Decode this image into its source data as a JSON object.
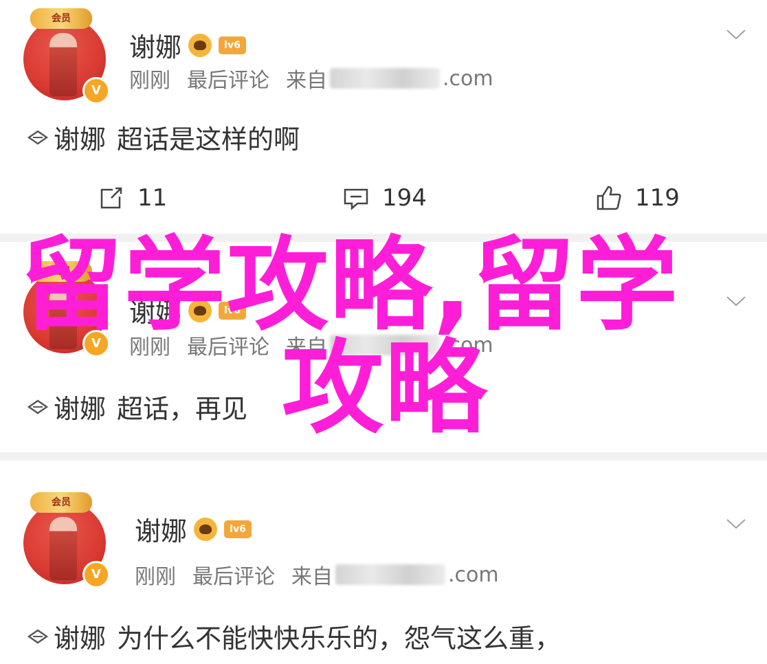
{
  "posts": [
    {
      "username": "谢娜",
      "avatar_deco": "会员",
      "badge_lv": "lv6",
      "meta_time": "刚刚",
      "meta_action": "最后评论",
      "meta_source_prefix": "来自",
      "meta_source_suffix": ".com",
      "comment_topic": "谢娜",
      "comment_text": "超话是这样的啊",
      "share_count": "11",
      "comment_count": "194",
      "like_count": "119"
    },
    {
      "username": "谢娜",
      "avatar_deco": "会员",
      "badge_lv": "lv6",
      "meta_time": "刚刚",
      "meta_action": "最后评论",
      "meta_source_prefix": "来自",
      "meta_source_suffix": ".com",
      "comment_topic": "谢娜",
      "comment_text": "超话，再见"
    },
    {
      "username": "谢娜",
      "avatar_deco": "会员",
      "badge_lv": "lv6",
      "meta_time": "刚刚",
      "meta_action": "最后评论",
      "meta_source_prefix": "来自",
      "meta_source_suffix": ".com",
      "comment_topic": "谢娜",
      "comment_text": "为什么不能快快乐乐的，怨气这么重，"
    }
  ],
  "watermark": {
    "line1": "留学攻略,留学",
    "line2": "攻略",
    "color": "#ff1ed8"
  },
  "icons": {
    "share": "share-icon",
    "comment": "comment-icon",
    "like": "thumbs-up-icon",
    "chevron": "chevron-down-icon",
    "topic": "topic-diamond-icon",
    "verify": "verified-v-icon"
  },
  "colors": {
    "avatar_bg": "#d93a32",
    "verify_badge": "#f6a623",
    "text_primary": "#333333",
    "text_meta": "#777777"
  }
}
